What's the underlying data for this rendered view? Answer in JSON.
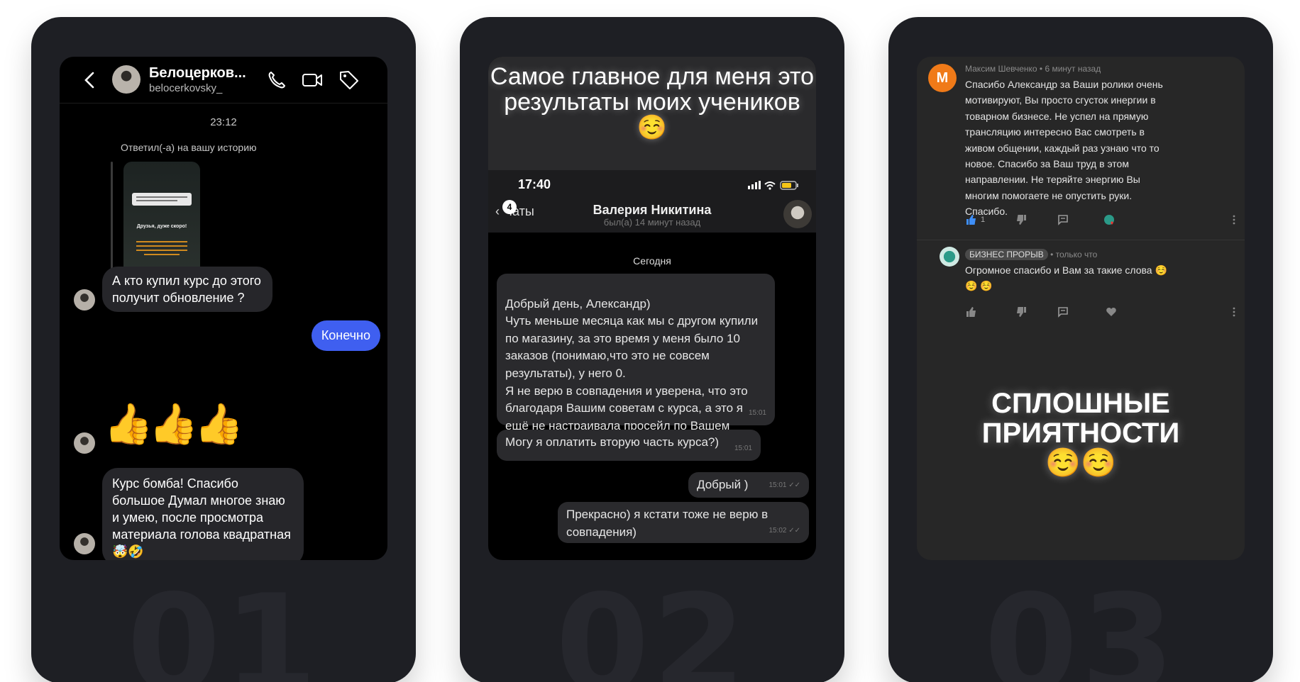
{
  "cards": [
    {
      "number": "01",
      "instagram": {
        "name": "Белоцерков...",
        "handle": "belocerkovsky_",
        "time": "23:12",
        "replied_label": "Ответил(-а) на вашу историю",
        "story_title": "Друзья, дуже скоро!",
        "messages": [
          "А кто купил курс до этого получит обновление ?",
          "Конечно",
          "👍👍👍",
          "Курс бомба! Спасибо большое Думал многое знаю и умею, после просмотра материала голова квадратная 🤯🤣"
        ]
      }
    },
    {
      "number": "02",
      "quote": "Самое главное для меня это результаты моих учеников ☺️",
      "telegram": {
        "clock": "17:40",
        "back_label": "Чаты",
        "unread_count": "4",
        "contact_name": "Валерия Никитина",
        "contact_status": "был(а) 14 минут назад",
        "day_label": "Сегодня",
        "messages": [
          {
            "text": "Добрый день, Александр)\nЧуть меньше месяца как мы с другом купили по магазину, за это время у меня было 10 заказов (понимаю,что это не совсем результаты), у него 0.\nЯ не верю в совпадения и уверена, что это благодаря Вашим советам с курса, а это я ещё не настраивала просейл по Вашем рекомендациям",
            "time": "15:01"
          },
          {
            "text": "Могу я оплатить вторую часть курса?)",
            "time": "15:01"
          },
          {
            "text": "Добрый )",
            "time": "15:01 ✓✓"
          },
          {
            "text": "Прекрасно) я кстати тоже не верю в совпадения)",
            "time": "15:02 ✓✓"
          }
        ]
      }
    },
    {
      "number": "03",
      "youtube": {
        "comment1": {
          "avatar_letter": "M",
          "meta": "Максим Шевченко • 6 минут назад",
          "text": "Спасибо Александр за Ваши ролики очень мотивируют, Вы просто сгусток инергии в товарном бизнесе. Не успел на прямую трансляцию интересно Вас смотреть в живом общении, каждый раз узнаю что то новое. Спасибо за Ваш труд в этом направлении. Не теряйте энергию Вы многим помогаете не опустить руки. Спасибо.",
          "likes": "1"
        },
        "comment2": {
          "channel_badge": "БИЗНЕС ПРОРЫВ",
          "meta": "• только что",
          "text": "Огромное спасибо и Вам за такие слова ☺️☺️ ☺️"
        },
        "caption": "СПЛОШНЫЕ ПРИЯТНОСТИ ☺️☺️"
      }
    }
  ],
  "colors": {
    "card_bg": "#1e1f24",
    "number_color": "#26272d",
    "ig_outgoing": "#3f5ff0",
    "yt_avatar": "#f07a18"
  }
}
